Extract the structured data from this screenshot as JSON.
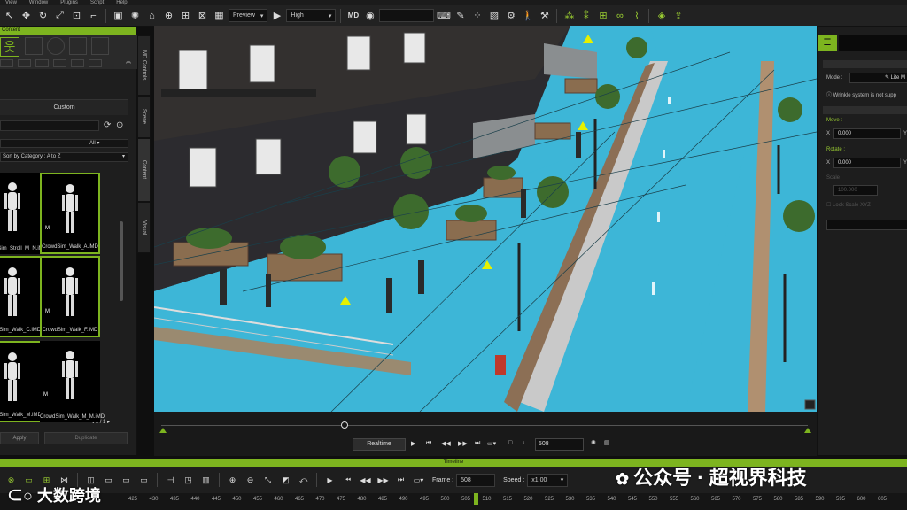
{
  "menu": [
    "View",
    "Window",
    "Plugins",
    "Script",
    "Help"
  ],
  "toolbar": {
    "preview_label": "Preview",
    "quality_label": "High",
    "search_placeholder": ""
  },
  "left_panel": {
    "header": "Content",
    "custom_label": "Custom",
    "filter_label": "All",
    "sort_label": "Sort by Category : A to Z",
    "items": [
      {
        "label": "CrowdSim_Stroll_M_N.iMD",
        "selected": false
      },
      {
        "label": "CrowdSim_Walk_A.iMD",
        "selected": true
      },
      {
        "label": "CrowdSim_Walk_C.iMD",
        "selected": true
      },
      {
        "label": "CrowdSim_Walk_F.iMD",
        "selected": true
      },
      {
        "label": "CrowdSim_Walk_M.iMD",
        "selected": true
      },
      {
        "label": "CrowdSim_Walk_M_M.iMD",
        "selected": false
      }
    ],
    "total_label": "Total : 21",
    "page_label": "1 / 1",
    "footer_btn_left": "Apply",
    "footer_btn_right": "Duplicate"
  },
  "side_tabs": [
    "MD Controls",
    "Scene",
    "Content",
    "Visual"
  ],
  "right_panel": {
    "mode_label": "Mode :",
    "mode_value": "Lite M",
    "warning": "Wrinkle system is not supp",
    "move_label": "Move :",
    "move_x_label": "X",
    "move_x": "0.000",
    "move_y_label": "Y",
    "rotate_label": "Rotate :",
    "rotate_x_label": "X",
    "rotate_x": "0.000",
    "rotate_y_label": "Y",
    "scale_label": "Scale",
    "scale_value": "100.000",
    "lock_label": "Lock Scale XYZ"
  },
  "playbar": {
    "realtime_label": "Realtime",
    "frame_value": "508"
  },
  "timeline": {
    "strip_label": "Timeline",
    "frame_label": "Frame :",
    "frame_value": "508",
    "speed_label": "Speed :",
    "speed_value": "x1.00",
    "ruler_start": 425,
    "ruler_step": 5,
    "ruler_count": 37,
    "current_frame": 508
  },
  "watermarks": {
    "right": "公众号 · 超视界科技",
    "left": "大数跨境"
  },
  "colors": {
    "accent": "#7db41f",
    "ground": "#3db6d7"
  }
}
